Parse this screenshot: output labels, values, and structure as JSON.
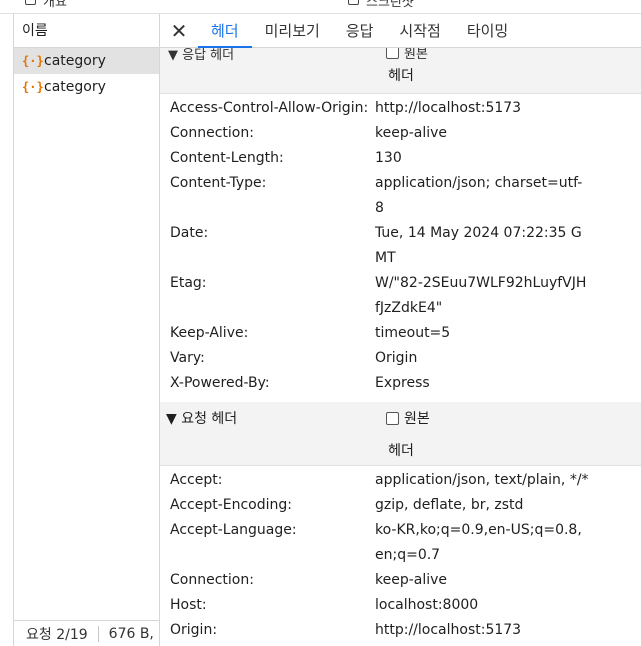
{
  "top": {
    "left_label": "개요",
    "right_label": "스크린샷"
  },
  "left_panel": {
    "header": "이름",
    "requests": [
      {
        "name": "category",
        "icon": "json-icon"
      },
      {
        "name": "category",
        "icon": "json-icon"
      }
    ],
    "footer": {
      "count": "요청 2/19",
      "size": "676 B,"
    }
  },
  "tabs": [
    "헤더",
    "미리보기",
    "응답",
    "시작점",
    "타이밍"
  ],
  "active_tab": 0,
  "response_section": {
    "title_clipped": "▼ 응답 헤더",
    "raw_label_clipped": "원본",
    "subtitle": "헤더",
    "headers": [
      {
        "name": "Access-Control-Allow-Origin:",
        "value": "http://localhost:5173"
      },
      {
        "name": "Connection:",
        "value": "keep-alive"
      },
      {
        "name": "Content-Length:",
        "value": "130"
      },
      {
        "name": "Content-Type:",
        "value": "application/json; charset=utf-8"
      },
      {
        "name": "Date:",
        "value": "Tue, 14 May 2024 07:22:35 GMT"
      },
      {
        "name": "Etag:",
        "value": "W/\"82-2SEuu7WLF92hLuyfVJHfJzZdkE4\""
      },
      {
        "name": "Keep-Alive:",
        "value": "timeout=5"
      },
      {
        "name": "Vary:",
        "value": "Origin"
      },
      {
        "name": "X-Powered-By:",
        "value": "Express"
      }
    ]
  },
  "request_section": {
    "title": "▼ 요청 헤더",
    "raw_label": "원본",
    "subtitle": "헤더",
    "headers": [
      {
        "name": "Accept:",
        "value": "application/json, text/plain, */*"
      },
      {
        "name": "Accept-Encoding:",
        "value": "gzip, deflate, br, zstd"
      },
      {
        "name": "Accept-Language:",
        "value": "ko-KR,ko;q=0.9,en-US;q=0.8,en;q=0.7"
      },
      {
        "name": "Connection:",
        "value": "keep-alive"
      },
      {
        "name": "Host:",
        "value": "localhost:8000"
      },
      {
        "name": "Origin:",
        "value": "http://localhost:5173"
      }
    ]
  }
}
